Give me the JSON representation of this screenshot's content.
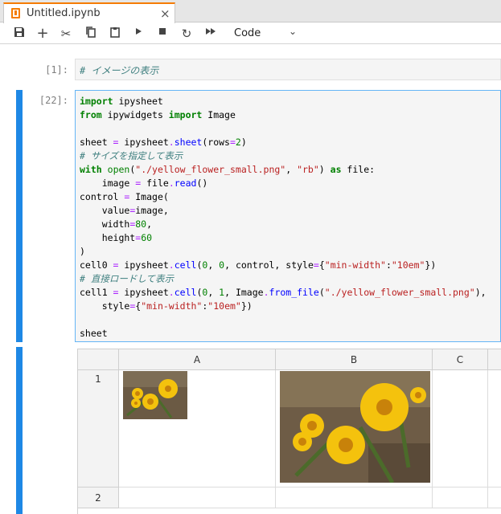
{
  "tab": {
    "title": "Untitled.ipynb",
    "close": "×"
  },
  "toolbar": {
    "save": "save-icon",
    "add": "plus-icon",
    "cut": "scissors-icon",
    "copy": "copy-icon",
    "paste": "clipboard-icon",
    "run": "play-icon",
    "stop": "stop-icon",
    "restart": "restart-icon",
    "run_all": "fast-forward-icon",
    "cell_type": "Code"
  },
  "cells": [
    {
      "prompt": "[1]:",
      "type": "markdown",
      "text": "# イメージの表示"
    },
    {
      "prompt": "[22]:",
      "type": "code"
    }
  ],
  "sheet": {
    "columns": [
      "A",
      "B",
      "C"
    ],
    "rows": [
      "1",
      "2"
    ]
  },
  "colors": {
    "accent": "#f57c00",
    "active_cell": "#1e88e5",
    "flower": "#f4c20d"
  }
}
